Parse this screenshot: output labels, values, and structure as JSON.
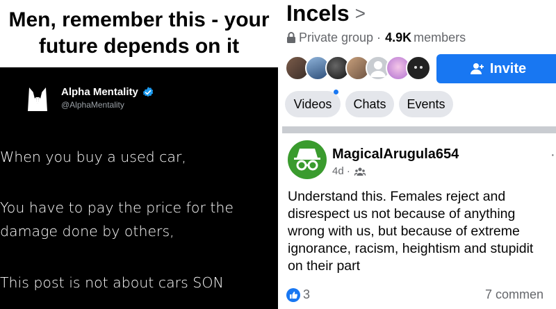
{
  "meme": {
    "caption_line1": "Men, remember this - your",
    "caption_line2": "future depends on it",
    "tweet": {
      "display_name": "Alpha Mentality",
      "handle": "@AlphaMentality",
      "verified_icon": "verified-badge-icon",
      "lines": [
        "When you buy a used car,",
        "You have to pay the price for the",
        "damage done by others,",
        "This post is not about cars SON"
      ]
    }
  },
  "group": {
    "title": "Incels",
    "title_chevron": ">",
    "privacy": "Private group ·",
    "members_count": "4.9K",
    "members_label": "members",
    "invite_label": "Invite",
    "tabs": [
      {
        "label": "Videos",
        "has_dot": true
      },
      {
        "label": "Chats",
        "has_dot": false
      },
      {
        "label": "Events",
        "has_dot": false
      }
    ]
  },
  "post": {
    "author": "MagicalArugula654",
    "time": "4d ·",
    "audience_icon": "group-audience-icon",
    "body_lines": [
      "Understand this. Females reject and",
      "disrespect us not because of anything",
      "wrong with us, but because of extreme",
      "ignorance, racism, heightism and stupidit",
      "on their part"
    ],
    "reactions_count": "3",
    "comments": "7 commen",
    "more_icon": "more-options-icon"
  },
  "colors": {
    "facebook_blue": "#1877f2",
    "verified_blue": "#1d9bf0",
    "post_avatar_green": "#3a9b2e",
    "tab_gray": "#e4e6eb"
  }
}
